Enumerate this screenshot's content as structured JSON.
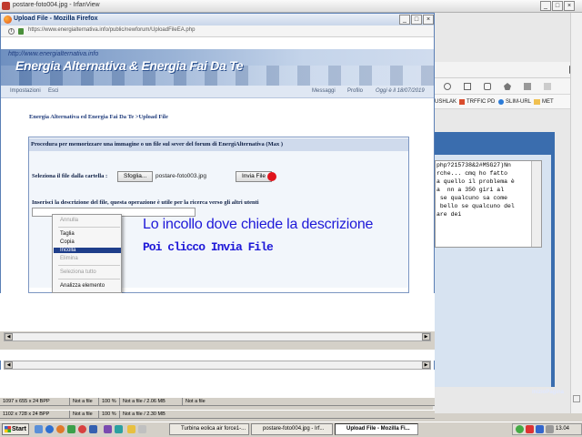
{
  "irfanview": {
    "title": "postare-foto004.jpg - IrfanView",
    "status_rows": [
      {
        "dims": "1097 x 655 x 24 BPP",
        "file": "Not a file",
        "zoom": "100 %",
        "mem": "Not a file / 2.06 MB",
        "extra": "Not a file"
      },
      {
        "dims": "1102 x 728 x 24 BPP",
        "file": "Not a file",
        "zoom": "100 %",
        "mem": "Not a file / 2.30 MB",
        "extra": ""
      }
    ]
  },
  "firefox": {
    "title": "Upload File - Mozilla Firefox",
    "url": "https://www.energialternativa.info/public/newforum/UploadFileEA.php"
  },
  "site": {
    "banner_url": "http://www.energialternativa.info",
    "banner_title": "Energia Alternativa & Energia Fai Da Te",
    "nav_left": [
      "Impostazioni",
      "Esci"
    ],
    "nav_right": [
      "Messaggi",
      "Profilo",
      "Oggi è il 18/07/2019"
    ],
    "breadcrumb": "Energia Alternativa ed Energia Fai Da Te >Upload File"
  },
  "upload": {
    "panel_title": "Procedura per memorizzare una immagine o un file sul sever del forum di EnergiAlternativa (Max )",
    "select_label": "Seleziona il file dalla cartella :",
    "browse_label": "Sfoglia...",
    "file_name": "postare-foto003.jpg",
    "send_label": "Invia File",
    "desc_label": "Inserisci la descrizione del file, questa operazione è utile per la ricerca verso gli altri utenti"
  },
  "context_menu": {
    "items": [
      "Annulla",
      "Taglia",
      "Copia",
      "Incolla",
      "Elimina",
      "Seleziona tutto",
      "Analizza elemento"
    ]
  },
  "annotations": {
    "line1": "Lo incollo dove chiede la descrizione",
    "line2": "Poi clicco Invia File"
  },
  "bookmarks": [
    "USHLAK",
    "TRFFIC PD",
    "SLIM-URL",
    "MET"
  ],
  "reply_text": "php?215738&2#MSG27)Nn\nrche... cmq ho fatto\na quello il problema è\na  nn a 350 giri al\n se qualcuno sa come\n bello se qualcuno del\nare dei",
  "inizio_pagina": "InizioPagina",
  "taskbar": {
    "start": "Start",
    "tasks": [
      "Turbina eolica air force1-...",
      "postare-foto004.jpg - Irf...",
      "Upload File - Mozilla Fi..."
    ],
    "time": "13.04"
  },
  "colors": {
    "annotation": "#1d18d8",
    "send_dot": "#e0141c",
    "menu_highlight": "#1f3e8a"
  }
}
